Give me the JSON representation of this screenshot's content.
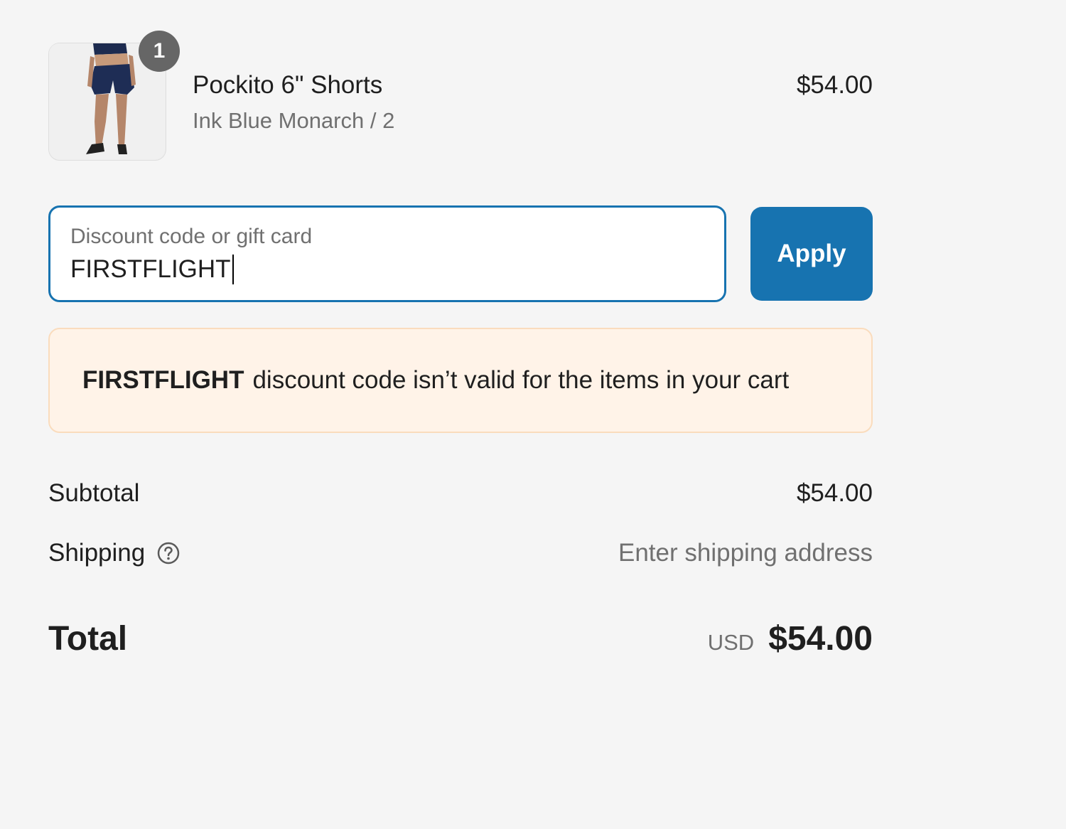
{
  "product": {
    "name": "Pockito 6\" Shorts",
    "variant": "Ink Blue Monarch / 2",
    "price": "$54.00",
    "quantity": "1"
  },
  "discount": {
    "label": "Discount code or gift card",
    "value": "FIRSTFLIGHT",
    "apply_label": "Apply"
  },
  "banner": {
    "code": "FIRSTFLIGHT",
    "message": "discount code isn’t valid for the items in your cart"
  },
  "totals": {
    "subtotal_label": "Subtotal",
    "subtotal_value": "$54.00",
    "shipping_label": "Shipping",
    "shipping_value": "Enter shipping address",
    "total_label": "Total",
    "currency": "USD",
    "total_value": "$54.00"
  },
  "colors": {
    "accent": "#1773b0",
    "banner_bg": "#fff3e8",
    "banner_border": "#fadcbd",
    "badge": "#666666"
  }
}
